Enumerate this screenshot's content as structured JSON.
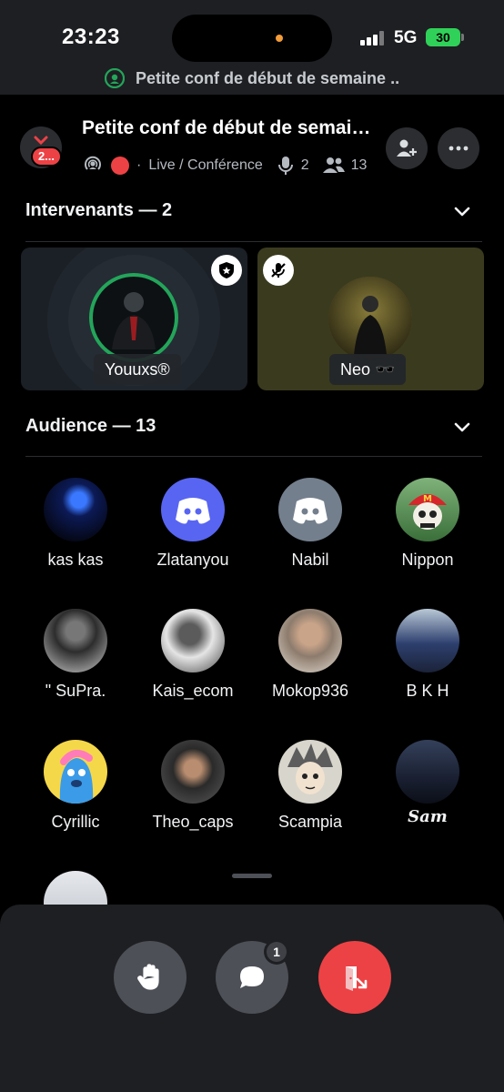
{
  "status_bar": {
    "time": "23:23",
    "network": "5G",
    "battery": "30"
  },
  "banner": {
    "text": "Petite conf de début de semaine .."
  },
  "header": {
    "badge": "2...",
    "title": "Petite conf de début de semaine ..",
    "category": "Live / Conférence",
    "speakers_count": "2",
    "listeners_count": "13"
  },
  "sections": {
    "speakers_title": "Intervenants — 2",
    "audience_title": "Audience — 13"
  },
  "speakers": [
    {
      "name": "Youuxs®"
    },
    {
      "name": "Neo 🕶️"
    }
  ],
  "audience": [
    {
      "name": "kas kas",
      "avatar": "blue-eye"
    },
    {
      "name": "Zlatanyou",
      "avatar": "discord-blurple"
    },
    {
      "name": "Nabil",
      "avatar": "discord-gray"
    },
    {
      "name": "Nippon",
      "avatar": "skull-cap"
    },
    {
      "name": "\" SuPra.",
      "avatar": "photo-bw"
    },
    {
      "name": "Kais_ecom",
      "avatar": "photo-bw"
    },
    {
      "name": "Mokop936",
      "avatar": "photo-bw"
    },
    {
      "name": "B K H",
      "avatar": "photo-color"
    },
    {
      "name": "Cyrillic",
      "avatar": "cartoon-yellow"
    },
    {
      "name": "Theo_caps",
      "avatar": "photo-dark"
    },
    {
      "name": "Scampia",
      "avatar": "anime"
    },
    {
      "name": "Sam",
      "avatar": "photo-dark"
    },
    {
      "name": "",
      "avatar": "photo-car"
    }
  ],
  "actions": {
    "chat_badge": "1"
  },
  "colors": {
    "accent_red": "#ed4245",
    "discord_blurple": "#5865f2",
    "online_green": "#23a55a"
  }
}
